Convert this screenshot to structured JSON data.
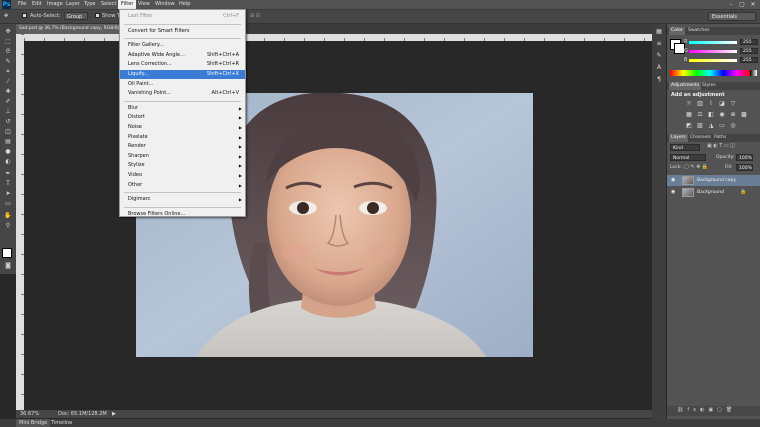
{
  "app": {
    "logo": "Ps"
  },
  "menubar": {
    "items": [
      "File",
      "Edit",
      "Image",
      "Layer",
      "Type",
      "Select",
      "Filter",
      "View",
      "Window",
      "Help"
    ],
    "active": "Filter",
    "window_controls": [
      "–",
      "▢",
      "✕"
    ]
  },
  "options_bar": {
    "auto_select_label": "Auto-Select:",
    "auto_select_value": "Group",
    "show_transform_label": "Show T",
    "workspace": "Essentials"
  },
  "document": {
    "tab_title": "Sad.psd @ 36.7% (Background copy, RGB/8) *",
    "zoom": "36.67%",
    "doc_size": "Doc: 65.1M/128.2M"
  },
  "filter_menu": {
    "items": [
      {
        "label": "Last Filter",
        "shortcut": "Ctrl+F",
        "disabled": true
      },
      {
        "sep": true
      },
      {
        "label": "Convert for Smart Filters"
      },
      {
        "sep": true
      },
      {
        "label": "Filter Gallery..."
      },
      {
        "label": "Adaptive Wide Angle...",
        "shortcut": "Shift+Ctrl+A"
      },
      {
        "label": "Lens Correction...",
        "shortcut": "Shift+Ctrl+R"
      },
      {
        "label": "Liquify...",
        "shortcut": "Shift+Ctrl+X",
        "highlighted": true
      },
      {
        "label": "Oil Paint..."
      },
      {
        "label": "Vanishing Point...",
        "shortcut": "Alt+Ctrl+V"
      },
      {
        "sep": true
      },
      {
        "label": "Blur",
        "submenu": true
      },
      {
        "label": "Distort",
        "submenu": true
      },
      {
        "label": "Noise",
        "submenu": true
      },
      {
        "label": "Pixelate",
        "submenu": true
      },
      {
        "label": "Render",
        "submenu": true
      },
      {
        "label": "Sharpen",
        "submenu": true
      },
      {
        "label": "Stylize",
        "submenu": true
      },
      {
        "label": "Video",
        "submenu": true
      },
      {
        "label": "Other",
        "submenu": true
      },
      {
        "sep": true
      },
      {
        "label": "Digimarc",
        "submenu": true
      },
      {
        "sep": true
      },
      {
        "label": "Browse Filters Online..."
      }
    ]
  },
  "color_panel": {
    "tabs": [
      "Color",
      "Swatches"
    ],
    "channels": [
      {
        "label": "R",
        "value": "255"
      },
      {
        "label": "G",
        "value": "255"
      },
      {
        "label": "B",
        "value": "255"
      }
    ]
  },
  "adjustments_panel": {
    "tabs": [
      "Adjustments",
      "Styles"
    ],
    "heading": "Add an adjustment"
  },
  "layers_panel": {
    "tabs": [
      "Layers",
      "Channels",
      "Paths"
    ],
    "kind": "Kind",
    "blend_mode": "Normal",
    "opacity_label": "Opacity:",
    "opacity": "100%",
    "lock_label": "Lock:",
    "fill_label": "Fill:",
    "fill": "100%",
    "layers": [
      {
        "name": "Background copy",
        "selected": true
      },
      {
        "name": "Background",
        "selected": false
      }
    ]
  },
  "bottom_tabs": [
    "Mini Bridge",
    "Timeline"
  ],
  "colors": {
    "accent": "#3a7bd5",
    "chrome": "#535353",
    "canvas": "#282828"
  }
}
